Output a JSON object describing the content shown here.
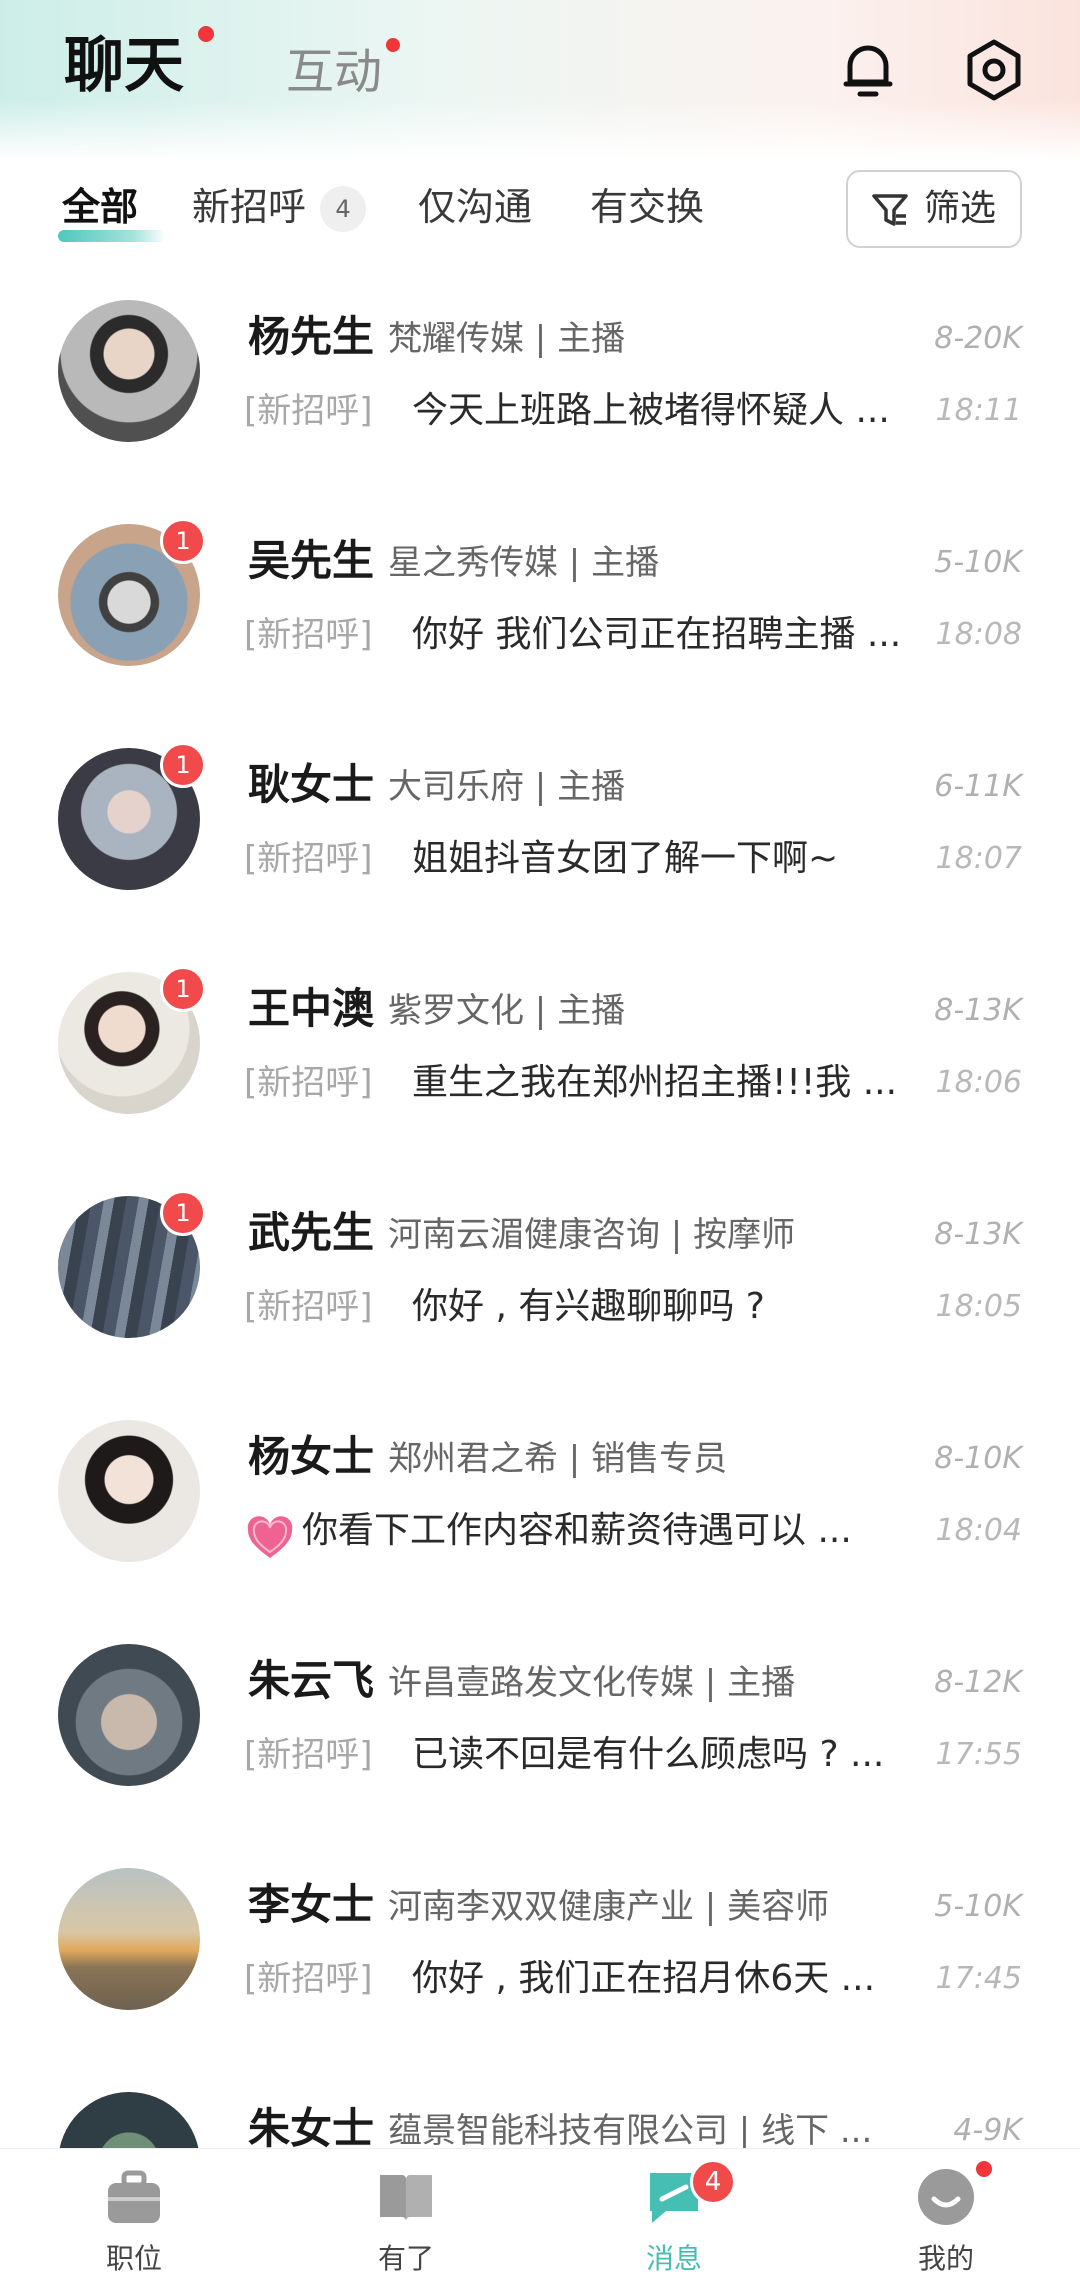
{
  "header": {
    "tabs": [
      {
        "label": "聊天",
        "active": true,
        "has_dot": true
      },
      {
        "label": "互动",
        "active": false,
        "has_dot": true
      }
    ],
    "icons": [
      "bell-icon",
      "settings-icon"
    ]
  },
  "filters": {
    "tabs": [
      {
        "label": "全部",
        "active": true
      },
      {
        "label": "新招呼",
        "count": "4"
      },
      {
        "label": "仅沟通"
      },
      {
        "label": "有交换"
      }
    ],
    "filter_button": "筛选"
  },
  "chats": [
    {
      "name": "杨先生",
      "company": "梵耀传媒 | 主播",
      "salary": "8-20K",
      "tag": "[新招呼]",
      "message": "今天上班路上被堵得怀疑人 ...",
      "time": "18:11",
      "unread": ""
    },
    {
      "name": "吴先生",
      "company": "星之秀传媒 | 主播",
      "salary": "5-10K",
      "tag": "[新招呼]",
      "message": "你好 我们公司正在招聘主播 ...",
      "time": "18:08",
      "unread": "1"
    },
    {
      "name": "耿女士",
      "company": "大司乐府 | 主播",
      "salary": "6-11K",
      "tag": "[新招呼]",
      "message": "姐姐抖音女团了解一下啊~",
      "time": "18:07",
      "unread": "1"
    },
    {
      "name": "王中澳",
      "company": "紫罗文化 | 主播",
      "salary": "8-13K",
      "tag": "[新招呼]",
      "message": "重生之我在郑州招主播!!!我 ...",
      "time": "18:06",
      "unread": "1"
    },
    {
      "name": "武先生",
      "company": "河南云湄健康咨询 | 按摩师",
      "salary": "8-13K",
      "tag": "[新招呼]",
      "message": "你好 , 有兴趣聊聊吗 ?",
      "time": "18:05",
      "unread": "1"
    },
    {
      "name": "杨女士",
      "company": "郑州君之希 | 销售专员",
      "salary": "8-10K",
      "tag": "",
      "message": "你看下工作内容和薪资待遇可以 ...",
      "time": "18:04",
      "unread": ""
    },
    {
      "name": "朱云飞",
      "company": "许昌壹路发文化传媒 | 主播",
      "salary": "8-12K",
      "tag": "[新招呼]",
      "message": "已读不回是有什么顾虑吗 ? ...",
      "time": "17:55",
      "unread": ""
    },
    {
      "name": "李女士",
      "company": "河南李双双健康产业 | 美容师",
      "salary": "5-10K",
      "tag": "[新招呼]",
      "message": "你好 , 我们正在招月休6天 ...",
      "time": "17:45",
      "unread": ""
    },
    {
      "name": "朱女士",
      "company": "蕴景智能科技有限公司 | 线下 ...",
      "salary": "4-9K",
      "tag": "",
      "message": "",
      "time": "",
      "unread": ""
    }
  ],
  "bottom_nav": [
    {
      "label": "职位",
      "icon": "briefcase-icon",
      "active": false
    },
    {
      "label": "有了",
      "icon": "book-icon",
      "active": false
    },
    {
      "label": "消息",
      "icon": "message-icon",
      "active": true,
      "badge": "4"
    },
    {
      "label": "我的",
      "icon": "profile-icon",
      "active": false,
      "has_dot": true
    }
  ],
  "colors": {
    "accent": "#45bfb3",
    "badge_red": "#f04a4a",
    "dot_red": "#f2353a"
  }
}
